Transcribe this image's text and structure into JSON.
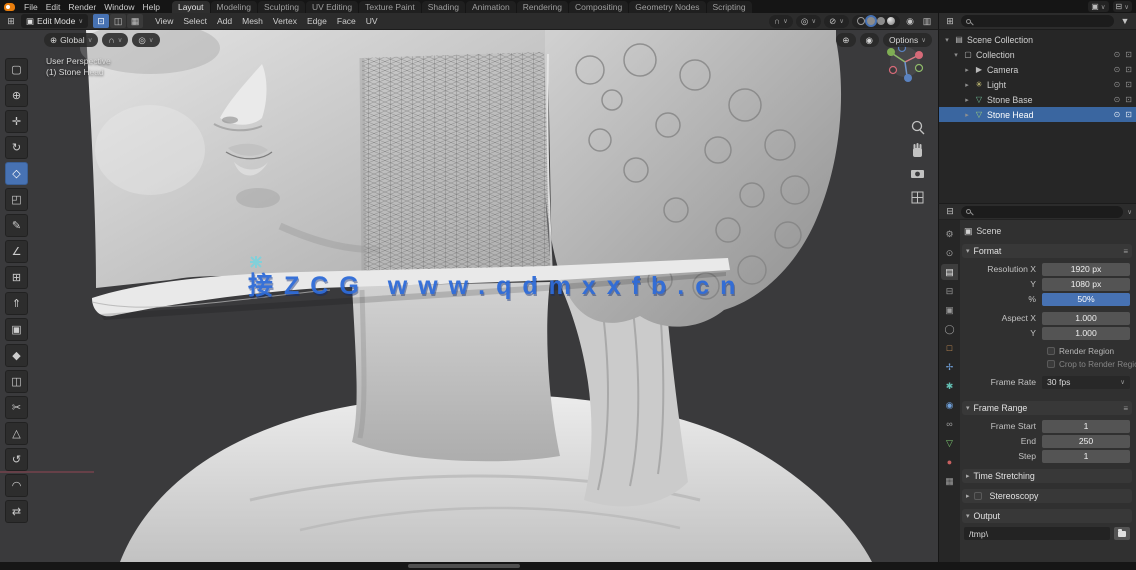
{
  "icons": {
    "chevron": "∨",
    "expand": "▾",
    "collapse": "▸",
    "editor_grid": "⊞",
    "mode_cube": "▣",
    "vertex": "⊡",
    "edge": "◫",
    "face": "▦",
    "orientation": "⊕",
    "magnet": "∩",
    "proportional": "◎",
    "visibility": "⊘",
    "overlays": "◉",
    "xray": "▥",
    "menu_lines": "≡",
    "filter": "▼",
    "scene": "▣",
    "view_layer": "⊟",
    "scene_collection": "▤",
    "collection": "▢",
    "camera_obj": "▶",
    "light_obj": "✳",
    "mesh_obj": "▽",
    "eye": "⊙",
    "camera_toggle": "⊡"
  },
  "topbar": {
    "menus": [
      "File",
      "Edit",
      "Render",
      "Window",
      "Help"
    ],
    "tabs": [
      "Layout",
      "Modeling",
      "Sculpting",
      "UV Editing",
      "Texture Paint",
      "Shading",
      "Animation",
      "Rendering",
      "Compositing",
      "Geometry Nodes",
      "Scripting"
    ]
  },
  "tool_header": {
    "mode": "Edit Mode",
    "menus": [
      "View",
      "Select",
      "Add",
      "Mesh",
      "Vertex",
      "Edge",
      "Face",
      "UV"
    ]
  },
  "viewport": {
    "orientation": "Global",
    "options": "Options",
    "overlay_line1": "User Perspective",
    "overlay_line2": "(1) Stone Head",
    "watermark": "接ZCG www.qdmxxfb.cn",
    "accent_color": "#4772b3",
    "watermark_color": "#2e6bd8",
    "axis_x_color": "#a84a5a"
  },
  "tools": [
    {
      "name": "select-box",
      "glyph": "▢"
    },
    {
      "name": "cursor",
      "glyph": "⊕"
    },
    {
      "name": "move",
      "glyph": "✛"
    },
    {
      "name": "rotate",
      "glyph": "↻"
    },
    {
      "name": "scale",
      "glyph": "◇"
    },
    {
      "name": "transform",
      "glyph": "◰"
    },
    {
      "name": "annotate",
      "glyph": "✎"
    },
    {
      "name": "measure",
      "glyph": "∠"
    },
    {
      "name": "add-cube",
      "glyph": "⊞"
    },
    {
      "name": "extrude-region",
      "glyph": "⇑"
    },
    {
      "name": "inset-faces",
      "glyph": "▣"
    },
    {
      "name": "bevel",
      "glyph": "◆"
    },
    {
      "name": "loop-cut",
      "glyph": "◫"
    },
    {
      "name": "knife",
      "glyph": "✂"
    },
    {
      "name": "poly-build",
      "glyph": "△"
    },
    {
      "name": "spin",
      "glyph": "↺"
    },
    {
      "name": "smooth",
      "glyph": "◠"
    },
    {
      "name": "edge-slide",
      "glyph": "⇄"
    }
  ],
  "outliner": {
    "rows": [
      {
        "label": "Scene Collection"
      },
      {
        "label": "Collection"
      },
      {
        "label": "Camera"
      },
      {
        "label": "Light"
      },
      {
        "label": "Stone Base"
      },
      {
        "label": "Stone Head"
      }
    ]
  },
  "prop_tabs": [
    {
      "name": "tool",
      "glyph": "⚙"
    },
    {
      "name": "render",
      "glyph": "⊙"
    },
    {
      "name": "output",
      "glyph": "▤"
    },
    {
      "name": "view-layer",
      "glyph": "⊟"
    },
    {
      "name": "scene",
      "glyph": "▣"
    },
    {
      "name": "world",
      "glyph": "◯"
    },
    {
      "name": "object",
      "glyph": "□"
    },
    {
      "name": "modifiers",
      "glyph": "✢"
    },
    {
      "name": "particles",
      "glyph": "✱"
    },
    {
      "name": "physics",
      "glyph": "◉"
    },
    {
      "name": "constraints",
      "glyph": "∞"
    },
    {
      "name": "object-data",
      "glyph": "▽"
    },
    {
      "name": "material",
      "glyph": "●"
    },
    {
      "name": "texture",
      "glyph": "▦"
    }
  ],
  "properties": {
    "breadcrumb": "Scene",
    "format": {
      "title": "Format",
      "res_x_label": "Resolution X",
      "res_x": "1920 px",
      "res_y_label": "Y",
      "res_y": "1080 px",
      "pct_label": "%",
      "pct": "50%",
      "aspect_x_label": "Aspect X",
      "aspect_x": "1.000",
      "aspect_y_label": "Y",
      "aspect_y": "1.000",
      "render_region": "Render Region",
      "crop_region": "Crop to Render Region",
      "fps_label": "Frame Rate",
      "fps": "30 fps"
    },
    "frame_range": {
      "title": "Frame Range",
      "start_label": "Frame Start",
      "start": "1",
      "end_label": "End",
      "end": "250",
      "step_label": "Step",
      "step": "1"
    },
    "time_stretching": "Time Stretching",
    "stereoscopy": "Stereoscopy",
    "output": {
      "title": "Output",
      "path": "/tmp\\"
    }
  }
}
